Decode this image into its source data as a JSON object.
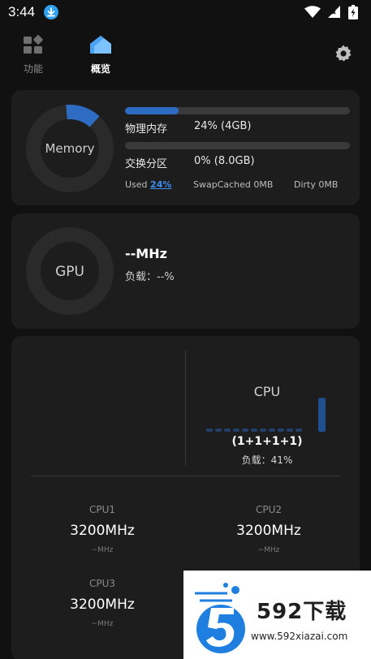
{
  "status_bar": {
    "time": "3:44"
  },
  "nav": {
    "func_label": "功能",
    "overview_label": "概览"
  },
  "memory": {
    "ring_label": "Memory",
    "ring_fraction": 0.24,
    "physical_label": "物理内存",
    "physical_value": "24% (4GB)",
    "physical_fraction": 0.24,
    "swap_label": "交换分区",
    "swap_value": "0% (8.0GB)",
    "swap_fraction": 0.0,
    "used_label": "Used",
    "used_value": "24%",
    "swapcached_label": "SwapCached",
    "swapcached_value": "0MB",
    "dirty_label": "Dirty",
    "dirty_value": "0MB"
  },
  "gpu": {
    "ring_label": "GPU",
    "freq": "--MHz",
    "load_label": "负载：",
    "load_value": "--%"
  },
  "cpu": {
    "title": "CPU",
    "cores_summary": "(1+1+1+1)",
    "load_label": "负载：",
    "load_value": "41%",
    "history_levels": [
      0,
      0,
      0,
      0,
      0,
      0,
      0,
      0,
      0,
      0,
      0,
      0.41
    ],
    "cores": [
      {
        "name": "CPU1",
        "freq": "3200MHz",
        "sub": "~MHz"
      },
      {
        "name": "CPU2",
        "freq": "3200MHz",
        "sub": "~MHz"
      },
      {
        "name": "CPU3",
        "freq": "3200MHz",
        "sub": "~MHz"
      }
    ]
  },
  "watermark": {
    "brand": "592下载",
    "url": "www.592xiazai.com"
  },
  "colors": {
    "accent": "#2e6cc3",
    "link": "#3c8ef0",
    "card": "#1d1d1d",
    "background": "#111111"
  }
}
